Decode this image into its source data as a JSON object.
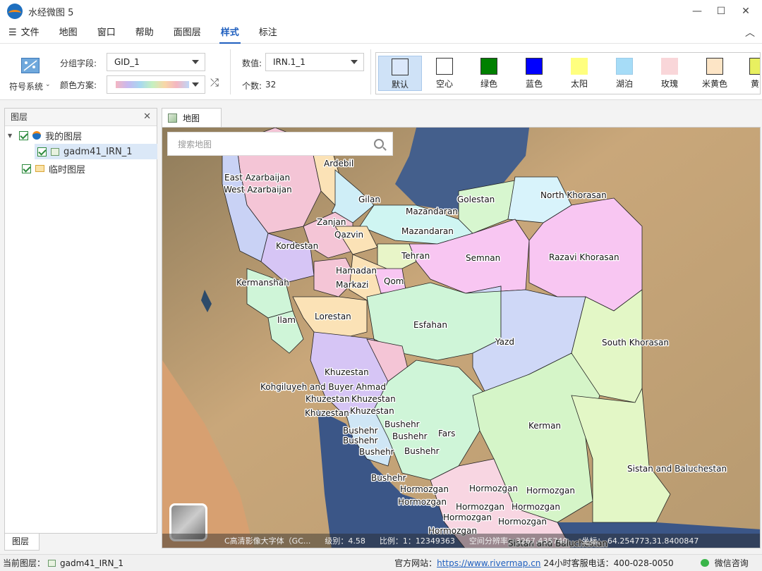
{
  "app": {
    "title": "水经微图 5"
  },
  "window_controls": {
    "minimize": "—",
    "maximize": "☐",
    "close": "✕"
  },
  "menu": {
    "hamburger": "☰",
    "items": [
      "文件",
      "地图",
      "窗口",
      "帮助",
      "面图层",
      "样式",
      "标注"
    ],
    "active_index": 5,
    "collapse_glyph": "︿"
  },
  "ribbon": {
    "symbol_system_label": "符号系统",
    "group_field_label": "分组字段:",
    "group_field_value": "GID_1",
    "color_scheme_label": "颜色方案:",
    "shuffle_glyph": "⤮",
    "value_label": "数值:",
    "value_value": "IRN.1_1",
    "count_label": "个数:",
    "count_value": "32",
    "swatches": [
      {
        "name": "默认",
        "color": "#dbe8fb",
        "selected": true
      },
      {
        "name": "空心",
        "color": "#ffffff",
        "selected": false
      },
      {
        "name": "绿色",
        "color": "#008000",
        "selected": false
      },
      {
        "name": "蓝色",
        "color": "#0000ff",
        "selected": false
      },
      {
        "name": "太阳",
        "color": "#ffff7f",
        "selected": false
      },
      {
        "name": "湖泊",
        "color": "#a6dcf7",
        "selected": false
      },
      {
        "name": "玫瑰",
        "color": "#f9d6d9",
        "selected": false
      },
      {
        "name": "米黄色",
        "color": "#fde5c6",
        "selected": false
      },
      {
        "name": "黄",
        "color": "#e8f060",
        "selected": false
      }
    ]
  },
  "layers_panel": {
    "title": "图层",
    "close": "✕",
    "tree": [
      {
        "label": "我的图层",
        "checked": true
      },
      {
        "label": "gadm41_IRN_1",
        "checked": true
      },
      {
        "label": "临时图层",
        "checked": true
      }
    ],
    "bottom_tab": "图层"
  },
  "map_tab": {
    "label": "地图"
  },
  "map": {
    "search_placeholder": "搜索地图",
    "status": {
      "basemap": "C高清影像大字体（GC...",
      "level": "级别：4.58",
      "scale": "比例：1：12349363",
      "resolution": "空间分辨率：3267.435740",
      "coords": "坐标：  64.254773,31.8400847"
    },
    "labels": [
      "East Azarbaijan",
      "West Azarbaijan",
      "Ardebil",
      "Gilan",
      "Golestan",
      "North Khorasan",
      "Mazandaran",
      "Mazandaran",
      "Zanjan",
      "Qazvin",
      "Kordestan",
      "Tehran",
      "Semnan",
      "Razavi Khorasan",
      "Hamadan",
      "Markazi",
      "Qom",
      "Kermanshah",
      "Ilam",
      "Lorestan",
      "Esfahan",
      "Yazd",
      "South Khorasan",
      "Khuzestan",
      "Kohgiluyeh and Buyer Ahmad",
      "Khuzestan",
      "Khuzestan",
      "Khuzestan",
      "Khuzestan",
      "Bushehr",
      "Bushehr",
      "Bushehr",
      "Bushehr",
      "Bushehr",
      "Fars",
      "Kerman",
      "Bushehr",
      "Bushehr",
      "Hormozgan",
      "Hormozgan",
      "Hormozgan",
      "Hormozgan",
      "Hormozgan",
      "Hormozgan",
      "Hormozgan",
      "Hormozgan",
      "Hormozgan",
      "Sistan and Baluchestan",
      "Sistan and Baluchestan"
    ]
  },
  "statusbar": {
    "current_layer_label": "当前图层：",
    "current_layer_value": "gadm41_IRN_1",
    "website_label": "官方网站：",
    "website_value": "https://www.rivermap.cn",
    "hotline": "24小时客服电话：400-028-0050",
    "wechat": "微信咨询"
  }
}
